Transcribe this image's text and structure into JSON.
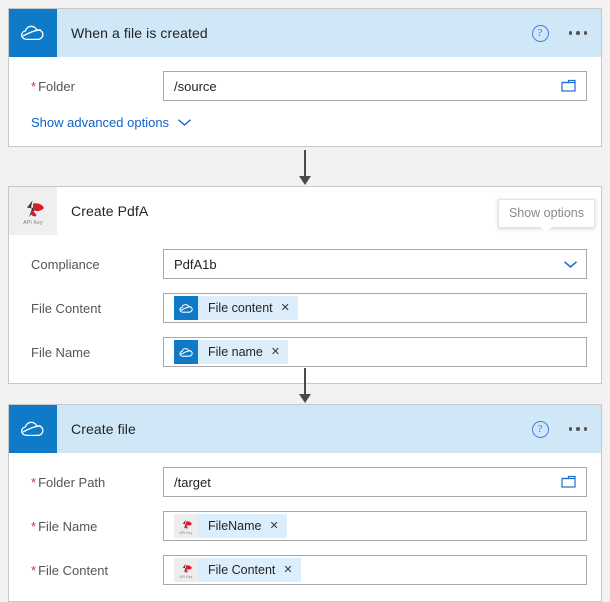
{
  "colors": {
    "header_blue": "#cfe7f7",
    "brand_blue": "#0f7ac7",
    "link_blue": "#0f62c8",
    "required_red": "#d0343a",
    "token_pill": "#dceefb",
    "canvas": "#f2f2f2"
  },
  "cards": [
    {
      "title": "When a file is created",
      "icon": "onedrive-cloud-icon",
      "header_style": "blue",
      "help_icon": "help-circle-icon",
      "more_icon": "more-options-icon",
      "fields": [
        {
          "label": "Folder",
          "required": true,
          "type": "text",
          "value": "/source",
          "trailing_icon": "folder-picker-icon"
        }
      ],
      "advanced_link": {
        "label": "Show advanced options",
        "icon": "chevron-down-icon"
      }
    },
    {
      "title": "Create PdfA",
      "icon": "api-key-icon",
      "icon_label": "API Key",
      "header_style": "plain",
      "help_icon": "help-circle-icon",
      "more_icon": "more-options-icon",
      "tooltip": "Show options",
      "fields": [
        {
          "label": "Compliance",
          "required": false,
          "type": "dropdown",
          "value": "PdfA1b",
          "trailing_icon": "chevron-down-icon"
        },
        {
          "label": "File Content",
          "required": false,
          "type": "token",
          "token": {
            "text": "File content",
            "icon": "onedrive-cloud-icon",
            "remove_icon": "remove-token-icon"
          }
        },
        {
          "label": "File Name",
          "required": false,
          "type": "token",
          "token": {
            "text": "File name",
            "icon": "onedrive-cloud-icon",
            "remove_icon": "remove-token-icon"
          }
        }
      ]
    },
    {
      "title": "Create file",
      "icon": "onedrive-cloud-icon",
      "header_style": "blue",
      "help_icon": "help-circle-icon",
      "more_icon": "more-options-icon",
      "fields": [
        {
          "label": "Folder Path",
          "required": true,
          "type": "text",
          "value": "/target",
          "trailing_icon": "folder-picker-icon"
        },
        {
          "label": "File Name",
          "required": true,
          "type": "token",
          "token": {
            "text": "FileName",
            "icon": "api-key-icon",
            "icon_label": "API Key",
            "remove_icon": "remove-token-icon"
          }
        },
        {
          "label": "File Content",
          "required": true,
          "type": "token",
          "token": {
            "text": "File Content",
            "icon": "api-key-icon",
            "icon_label": "API Key",
            "remove_icon": "remove-token-icon"
          }
        }
      ]
    }
  ],
  "connectors": [
    {
      "name": "connector-trigger-to-pdfa"
    },
    {
      "name": "connector-pdfa-to-createfile"
    }
  ]
}
